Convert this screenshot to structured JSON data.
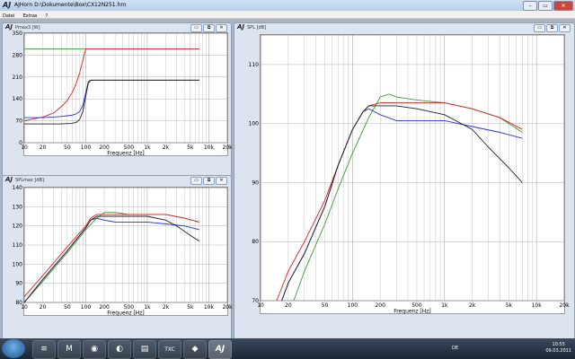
{
  "window": {
    "title": "AJHorn   D:\\Dokumente\\Box\\CX12N251.hrn",
    "logo": "AJ"
  },
  "menu": [
    "Datei",
    "Extras",
    "?"
  ],
  "panels": {
    "pmax": {
      "label": "Pmax3 [W]",
      "xlabel": "Frequenz [Hz]",
      "yticks": [
        "350",
        "280",
        "210",
        "140",
        "70",
        "0"
      ],
      "xticks": [
        "10",
        "20",
        "50",
        "100",
        "200",
        "500",
        "1k",
        "2k",
        "5k",
        "10k",
        "20k"
      ]
    },
    "splmax": {
      "label": "SPLmax [dB]",
      "xlabel": "Frequenz [Hz]",
      "yticks": [
        "140",
        "130",
        "120",
        "110",
        "100",
        "90",
        "80"
      ],
      "xticks": [
        "10",
        "20",
        "50",
        "100",
        "200",
        "500",
        "1k",
        "2k",
        "5k",
        "10k",
        "20k"
      ]
    },
    "spl": {
      "label": "SPL [dB]",
      "xlabel": "Frequenz [Hz]",
      "yticks": [
        "110",
        "100",
        "90",
        "80",
        "70"
      ],
      "xticks": [
        "10",
        "20",
        "50",
        "100",
        "200",
        "500",
        "1k",
        "2k",
        "5k",
        "10k",
        "20k"
      ]
    }
  },
  "chart_data": [
    {
      "type": "line",
      "title": "Pmax3 [W]",
      "xlabel": "Frequenz [Hz]",
      "ylabel": "",
      "xscale": "log",
      "xlim": [
        10,
        20000
      ],
      "ylim": [
        0,
        350
      ],
      "grid": true,
      "series": [
        {
          "color": "#3a9a3a",
          "x": [
            10,
            7000
          ],
          "y": [
            300,
            300
          ]
        },
        {
          "color": "#e02020",
          "x": [
            10,
            20,
            30,
            40,
            50,
            60,
            70,
            80,
            90,
            100,
            7000
          ],
          "y": [
            70,
            82,
            95,
            115,
            135,
            160,
            190,
            225,
            265,
            300,
            300
          ]
        },
        {
          "color": "#2030e0",
          "x": [
            10,
            20,
            30,
            40,
            50,
            60,
            70,
            80,
            90,
            100,
            110,
            120,
            7000
          ],
          "y": [
            80,
            80,
            82,
            84,
            86,
            88,
            92,
            100,
            120,
            160,
            195,
            200,
            200
          ]
        },
        {
          "color": "#202020",
          "x": [
            10,
            20,
            30,
            40,
            50,
            60,
            70,
            80,
            90,
            100,
            110,
            120,
            7000
          ],
          "y": [
            60,
            60,
            60,
            60,
            61,
            62,
            65,
            75,
            100,
            150,
            190,
            200,
            200
          ]
        }
      ]
    },
    {
      "type": "line",
      "title": "SPLmax [dB]",
      "xlabel": "Frequenz [Hz]",
      "ylabel": "",
      "xscale": "log",
      "xlim": [
        10,
        20000
      ],
      "ylim": [
        80,
        140
      ],
      "grid": true,
      "series": [
        {
          "color": "#3a9a3a",
          "x": [
            10,
            20,
            50,
            100,
            150,
            200,
            300,
            500,
            1000,
            2000,
            4000,
            7000
          ],
          "y": [
            80,
            91,
            106,
            118,
            124,
            127,
            127,
            126,
            126,
            126,
            124,
            122
          ]
        },
        {
          "color": "#e02020",
          "x": [
            10,
            20,
            50,
            100,
            120,
            150,
            200,
            300,
            500,
            1000,
            2000,
            4000,
            7000
          ],
          "y": [
            83,
            94,
            109,
            120,
            124,
            126,
            126,
            126,
            126,
            126,
            126,
            124,
            122
          ]
        },
        {
          "color": "#2030e0",
          "x": [
            10,
            20,
            50,
            100,
            120,
            150,
            200,
            300,
            500,
            1000,
            2000,
            4000,
            7000
          ],
          "y": [
            80,
            92,
            107,
            119,
            123,
            124,
            123,
            122,
            122,
            122,
            121,
            120,
            118
          ]
        },
        {
          "color": "#202020",
          "x": [
            10,
            20,
            50,
            100,
            120,
            150,
            200,
            300,
            500,
            1000,
            2000,
            3000,
            5000,
            7000
          ],
          "y": [
            80,
            92,
            107,
            119,
            123,
            125,
            125,
            125,
            125,
            125,
            123,
            120,
            115,
            112
          ]
        }
      ]
    },
    {
      "type": "line",
      "title": "SPL [dB]",
      "xlabel": "Frequenz [Hz]",
      "ylabel": "",
      "xscale": "log",
      "xlim": [
        10,
        20000
      ],
      "ylim": [
        70,
        115
      ],
      "grid": true,
      "series": [
        {
          "color": "#3a9a3a",
          "x": [
            23,
            30,
            50,
            70,
            100,
            150,
            200,
            250,
            300,
            500,
            1000,
            2000,
            4000,
            7000
          ],
          "y": [
            70,
            75,
            83,
            89,
            95,
            101,
            104.5,
            105,
            104.5,
            104,
            103.5,
            102.5,
            101,
            98.5
          ]
        },
        {
          "color": "#e02020",
          "x": [
            15,
            20,
            30,
            50,
            70,
            100,
            130,
            150,
            200,
            300,
            500,
            1000,
            2000,
            4000,
            7000
          ],
          "y": [
            70,
            75,
            80,
            87,
            93,
            99,
            102,
            103,
            103.5,
            103.5,
            103.5,
            103.5,
            102.5,
            101,
            99
          ]
        },
        {
          "color": "#2030e0",
          "x": [
            17,
            20,
            30,
            50,
            70,
            100,
            130,
            150,
            200,
            300,
            500,
            1000,
            2000,
            4000,
            7000
          ],
          "y": [
            70,
            73,
            78,
            86,
            93,
            99,
            102,
            102.5,
            101.5,
            100.5,
            100.5,
            100.5,
            99.5,
            98.5,
            97.5
          ]
        },
        {
          "color": "#202020",
          "x": [
            17,
            20,
            30,
            50,
            70,
            100,
            130,
            150,
            200,
            300,
            500,
            1000,
            2000,
            3000,
            5000,
            7000
          ],
          "y": [
            70,
            73,
            78,
            86,
            93,
            99,
            102,
            103,
            103,
            103,
            102.5,
            101.5,
            99,
            96,
            92.5,
            90
          ]
        }
      ]
    }
  ],
  "taskbar": {
    "apps": [
      "≡",
      "M",
      "◉",
      "◐",
      "▤",
      "TXC",
      "◆",
      "AJ"
    ],
    "lang": "DE",
    "time": "10:55",
    "date": "09.03.2011"
  }
}
